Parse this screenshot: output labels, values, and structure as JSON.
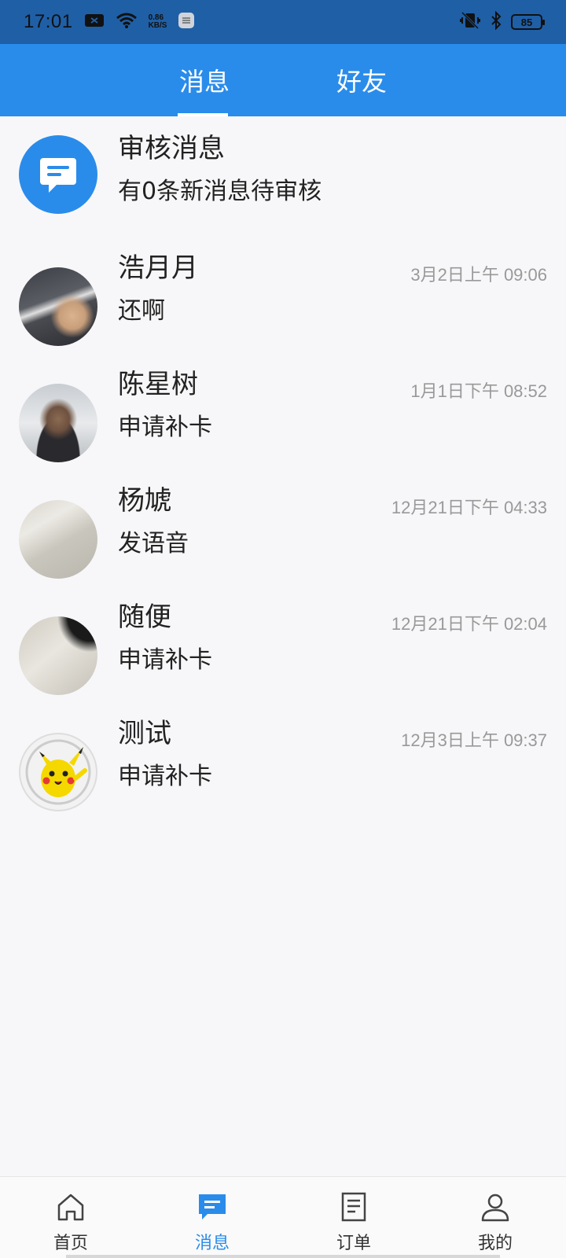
{
  "status_bar": {
    "time": "17:01",
    "net_speed_value": "0.86",
    "net_speed_unit": "KB/S",
    "battery": "85"
  },
  "top_tabs": [
    {
      "label": "消息",
      "active": true
    },
    {
      "label": "好友",
      "active": false
    }
  ],
  "review": {
    "title": "审核消息",
    "subtitle": "有0条新消息待审核"
  },
  "messages": [
    {
      "name": "浩月月",
      "preview": "还啊",
      "time": "3月2日上午 09:06"
    },
    {
      "name": "陈星树",
      "preview": "申请补卡",
      "time": "1月1日下午 08:52"
    },
    {
      "name": "杨虓",
      "preview": "发语音",
      "time": "12月21日下午 04:33"
    },
    {
      "name": "随便",
      "preview": "申请补卡",
      "time": "12月21日下午 02:04"
    },
    {
      "name": "测试",
      "preview": "申请补卡",
      "time": "12月3日上午 09:37"
    }
  ],
  "bottom_nav": [
    {
      "label": "首页",
      "icon": "home-icon",
      "active": false
    },
    {
      "label": "消息",
      "icon": "message-icon",
      "active": true
    },
    {
      "label": "订单",
      "icon": "order-icon",
      "active": false
    },
    {
      "label": "我的",
      "icon": "profile-icon",
      "active": false
    }
  ],
  "colors": {
    "accent": "#2a8cea",
    "status_bar": "#1f5fa6",
    "time_text": "#999999"
  }
}
